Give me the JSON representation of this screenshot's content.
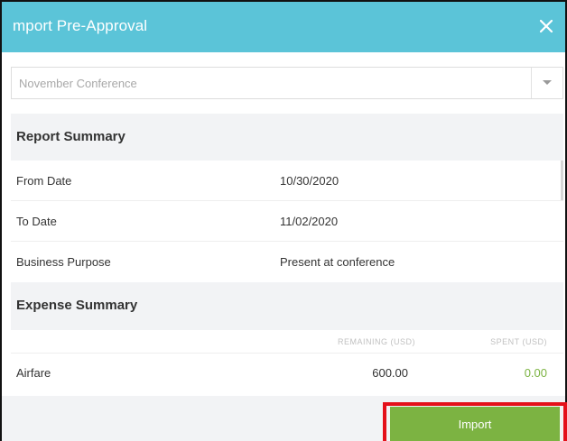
{
  "dialog": {
    "title": "mport Pre-Approval",
    "close_glyph": "✕",
    "close_icon": "close-icon",
    "accent_color": "#5bc4d8"
  },
  "select": {
    "value": "November Conference",
    "icon": "chevron-down-icon"
  },
  "report_summary": {
    "heading": "Report Summary",
    "rows": [
      {
        "label": "From Date",
        "value": "10/30/2020"
      },
      {
        "label": "To Date",
        "value": "11/02/2020"
      },
      {
        "label": "Business Purpose",
        "value": "Present at conference"
      }
    ]
  },
  "expense_summary": {
    "heading": "Expense Summary",
    "columns": {
      "remaining": "REMAINING (USD)",
      "spent": "SPENT (USD)"
    },
    "rows": [
      {
        "name": "Airfare",
        "remaining": "600.00",
        "spent": "0.00"
      }
    ]
  },
  "footer": {
    "import_label": "Import",
    "import_color": "#7cb342",
    "highlight_color": "#e4101a"
  }
}
